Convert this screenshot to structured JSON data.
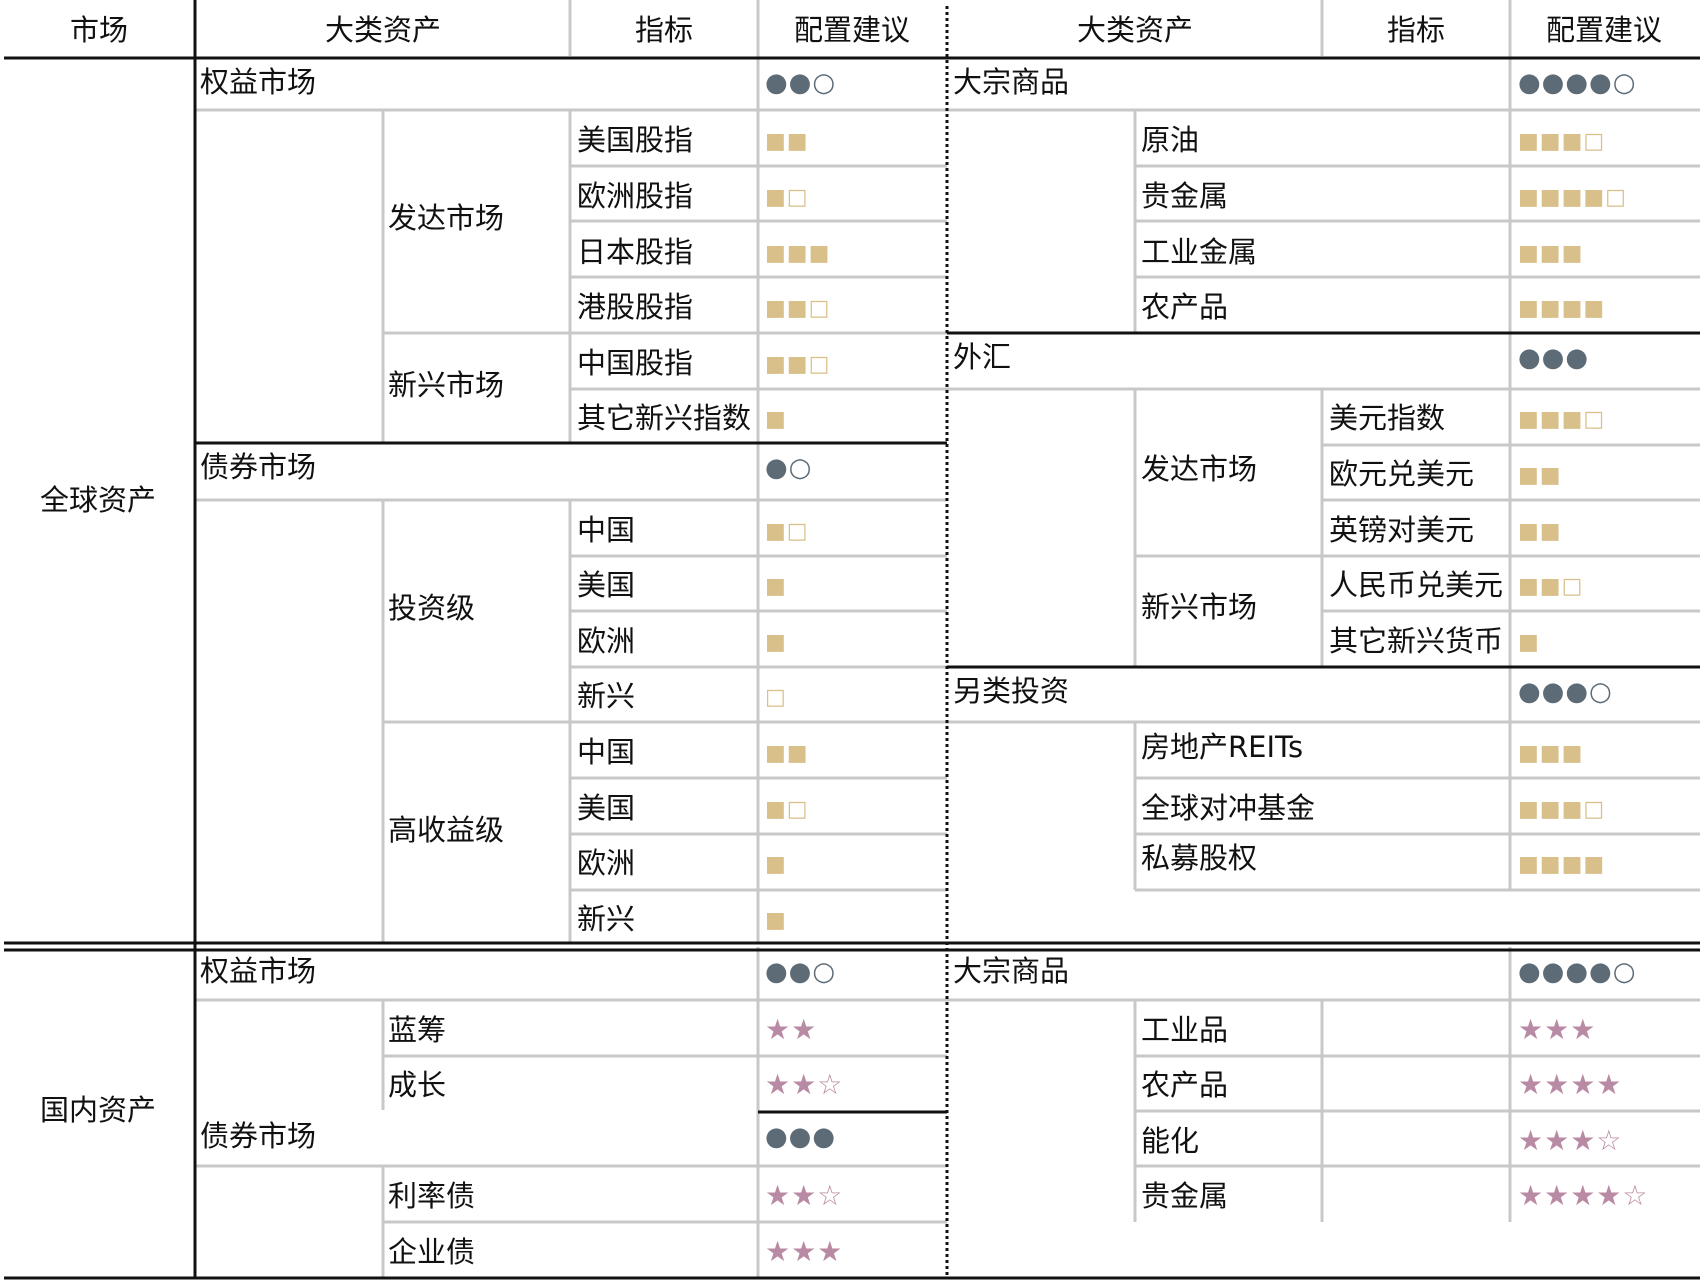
{
  "header": {
    "market": "市场",
    "asset_class_left": "大类资产",
    "indicator_left": "指标",
    "advice_left": "配置建议",
    "asset_class_right": "大类资产",
    "indicator_right": "指标",
    "advice_right": "配置建议"
  },
  "global": {
    "label": "全球资产",
    "equity": {
      "label": "权益市场",
      "rating": "●●○",
      "developed_label": "发达市场",
      "developed": [
        {
          "name": "美国股指",
          "rating": "■■"
        },
        {
          "name": "欧洲股指",
          "rating": "■□"
        },
        {
          "name": "日本股指",
          "rating": "■■■"
        },
        {
          "name": "港股股指",
          "rating": "■■□"
        }
      ],
      "emerging_label": "新兴市场",
      "emerging": [
        {
          "name": "中国股指",
          "rating": "■■□"
        },
        {
          "name": "其它新兴指数",
          "rating": "■"
        }
      ]
    },
    "bond": {
      "label": "债券市场",
      "rating": "●○",
      "ig_label": "投资级",
      "ig": [
        {
          "name": "中国",
          "rating": "■□"
        },
        {
          "name": "美国",
          "rating": "■"
        },
        {
          "name": "欧洲",
          "rating": "■"
        },
        {
          "name": "新兴",
          "rating": "□"
        }
      ],
      "hy_label": "高收益级",
      "hy": [
        {
          "name": "中国",
          "rating": "■■"
        },
        {
          "name": "美国",
          "rating": "■□"
        },
        {
          "name": "欧洲",
          "rating": "■"
        },
        {
          "name": "新兴",
          "rating": "■"
        }
      ]
    },
    "commodity": {
      "label": "大宗商品",
      "rating": "●●●●○",
      "items": [
        {
          "name": "原油",
          "rating": "■■■□"
        },
        {
          "name": "贵金属",
          "rating": "■■■■□"
        },
        {
          "name": "工业金属",
          "rating": "■■■"
        },
        {
          "name": "农产品",
          "rating": "■■■■"
        }
      ]
    },
    "fx": {
      "label": "外汇",
      "rating": "●●●",
      "developed_label": "发达市场",
      "developed": [
        {
          "name": "美元指数",
          "rating": "■■■□"
        },
        {
          "name": "欧元兑美元",
          "rating": "■■"
        },
        {
          "name": "英镑对美元",
          "rating": "■■"
        }
      ],
      "emerging_label": "新兴市场",
      "emerging": [
        {
          "name": "人民币兑美元",
          "rating": "■■□"
        },
        {
          "name": "其它新兴货币",
          "rating": "■"
        }
      ]
    },
    "alt": {
      "label": "另类投资",
      "rating": "●●●○",
      "items": [
        {
          "name": "房地产REITs",
          "rating": "■■■"
        },
        {
          "name": "全球对冲基金",
          "rating": "■■■□"
        },
        {
          "name": "私募股权",
          "rating": "■■■■"
        }
      ]
    }
  },
  "domestic": {
    "label": "国内资产",
    "equity": {
      "label": "权益市场",
      "rating": "●●○",
      "items": [
        {
          "name": "蓝筹",
          "rating": "★★"
        },
        {
          "name": "成长",
          "rating": "★★☆"
        }
      ]
    },
    "bond": {
      "label": "债券市场",
      "rating": "●●●",
      "items": [
        {
          "name": "利率债",
          "rating": "★★☆"
        },
        {
          "name": "企业债",
          "rating": "★★★"
        }
      ]
    },
    "commodity": {
      "label": "大宗商品",
      "rating": "●●●●○",
      "items": [
        {
          "name": "工业品",
          "rating": "★★★"
        },
        {
          "name": "农产品",
          "rating": "★★★★"
        },
        {
          "name": "能化",
          "rating": "★★★☆"
        },
        {
          "name": "贵金属",
          "rating": "★★★★☆"
        }
      ]
    }
  }
}
